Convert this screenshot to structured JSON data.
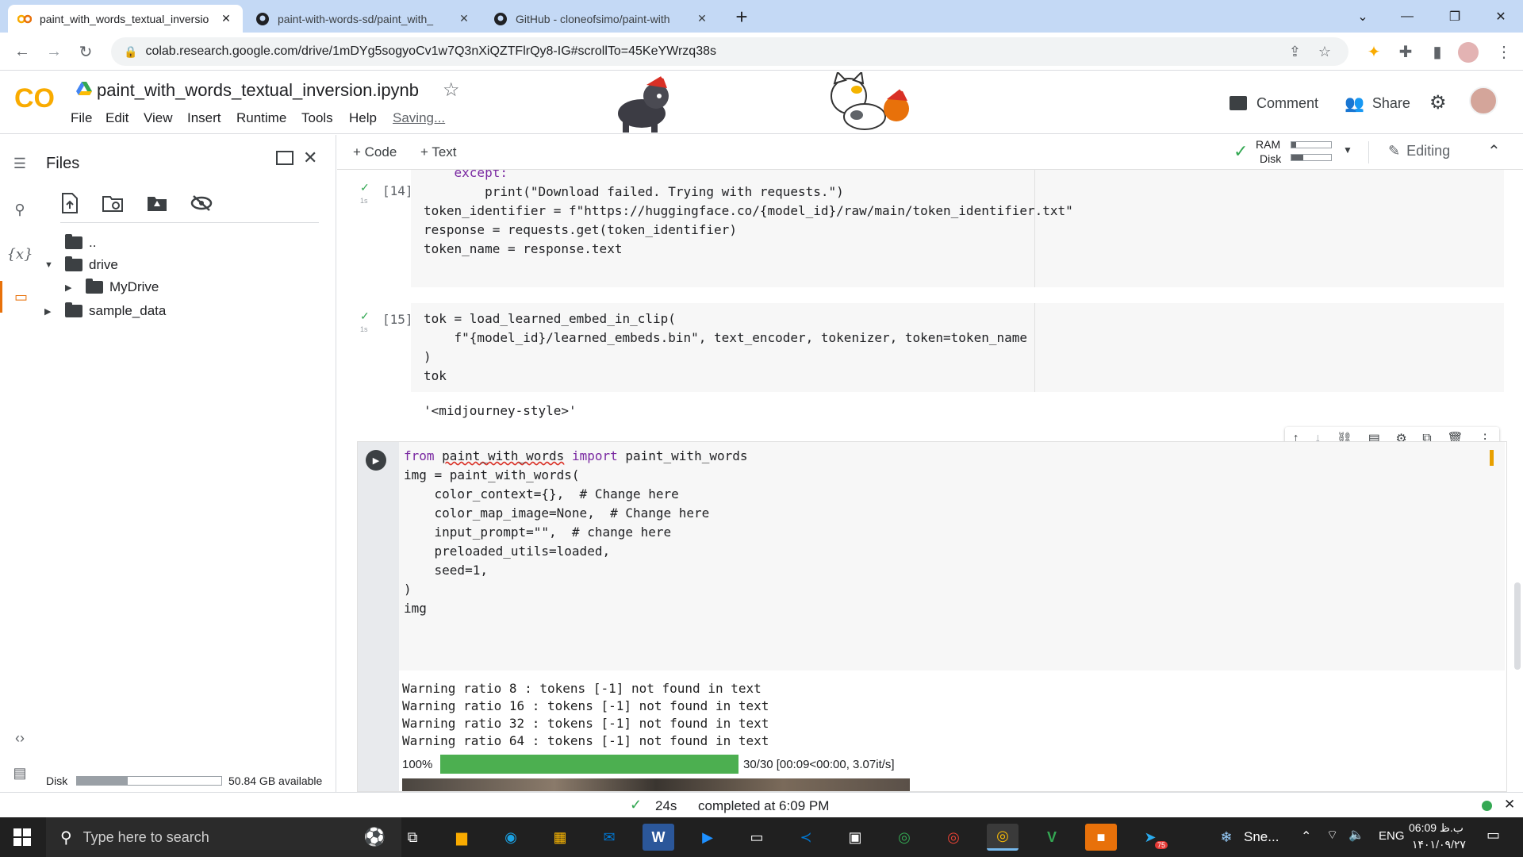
{
  "browser": {
    "tabs": [
      {
        "title": "paint_with_words_textual_inversio",
        "close": "✕",
        "icon": "colab-co-icon"
      },
      {
        "title": "paint-with-words-sd/paint_with_",
        "close": "✕",
        "icon": "github-icon"
      },
      {
        "title": "GitHub - cloneofsimo/paint-with",
        "close": "✕",
        "icon": "github-icon"
      }
    ],
    "new_tab": "+",
    "url": "colab.research.google.com/drive/1mDYg5sogyoCv1w7Q3nXiQZTFlrQy8-IG#scrollTo=45KeYWrzq38s"
  },
  "colab": {
    "logo": "CO",
    "notebook_title": "paint_with_words_textual_inversion.ipynb",
    "menu": [
      "File",
      "Edit",
      "View",
      "Insert",
      "Runtime",
      "Tools",
      "Help"
    ],
    "saving": "Saving...",
    "comment_label": "Comment",
    "share_label": "Share"
  },
  "files_panel": {
    "title": "Files",
    "tree": [
      {
        "label": "..",
        "icon": "folder-up-icon"
      },
      {
        "label": "drive",
        "icon": "folder-icon",
        "expanded": true
      },
      {
        "label": "MyDrive",
        "icon": "folder-icon"
      },
      {
        "label": "sample_data",
        "icon": "folder-icon"
      }
    ],
    "disk_label": "Disk",
    "disk_available": "50.84 GB available",
    "disk_used_fraction": 0.35
  },
  "toolbar": {
    "add_code": "+ Code",
    "add_text": "+ Text",
    "ram_label": "RAM",
    "disk_label": "Disk",
    "ram_fraction": 0.12,
    "disk_fraction": 0.3,
    "editing_label": "Editing"
  },
  "cells": [
    {
      "exec_count": "[14]",
      "time": "1s",
      "lines": [
        "    except:",
        "        print(\"Download failed. Trying with requests.\")",
        "",
        "token_identifier = f\"https://huggingface.co/{model_id}/raw/main/token_identifier.txt\"",
        "response = requests.get(token_identifier)",
        "token_name = response.text"
      ]
    },
    {
      "exec_count": "[15]",
      "time": "1s",
      "lines": [
        "tok = load_learned_embed_in_clip(",
        "    f\"{model_id}/learned_embeds.bin\", text_encoder, tokenizer, token=token_name",
        ")",
        "tok"
      ],
      "output": "'<midjourney-style>'"
    },
    {
      "time": "24s",
      "lines": [
        "from paint_with_words import paint_with_words",
        "",
        "img = paint_with_words(",
        "    color_context={},  # Change here",
        "    color_map_image=None,  # Change here",
        "    input_prompt=\"\",  # change here",
        "    preloaded_utils=loaded,",
        "    seed=1,",
        ")",
        "",
        "img"
      ],
      "output_lines": [
        "Warning ratio 8 : tokens [-1] not found in text",
        "Warning ratio 16 : tokens [-1] not found in text",
        "Warning ratio 32 : tokens [-1] not found in text",
        "Warning ratio 64 : tokens [-1] not found in text"
      ],
      "progress_pct": "100%",
      "progress_fraction": 1.0,
      "progress_text": "30/30 [00:09<00:00, 3.07it/s]"
    }
  ],
  "status": {
    "time": "24s",
    "message": "completed at 6:09 PM"
  },
  "taskbar": {
    "search_placeholder": "Type here to search",
    "weather": "Sne...",
    "lang": "ENG",
    "clock_time": "06:09 ب.ظ",
    "clock_date": "۱۴۰۱/۰۹/۲۷",
    "telegram_badge": "75"
  },
  "colors": {
    "accent": "#1a73e8",
    "progress": "#4caf50",
    "tabbar": "#c4d9f5",
    "taskbar": "#202020"
  }
}
